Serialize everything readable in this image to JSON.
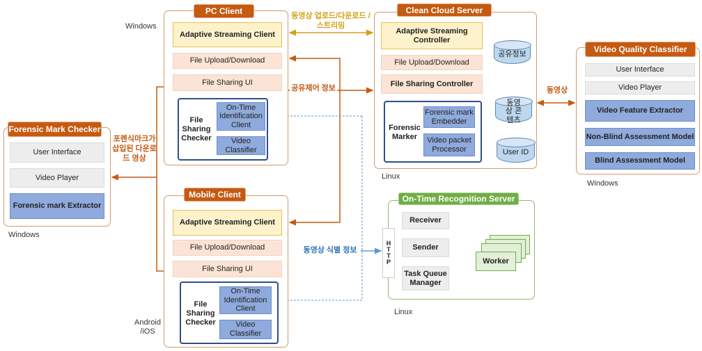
{
  "pc_client": {
    "title": "PC Client",
    "os": "Windows",
    "asc": "Adaptive Streaming Client",
    "fud": "File Upload/Download",
    "fsui": "File Sharing UI",
    "fsc_label": "File Sharing Checker",
    "otic": "On-Time Identification Client",
    "vc": "Video Classifier"
  },
  "mobile_client": {
    "title": "Mobile Client",
    "os": "Android /iOS",
    "asc": "Adaptive Streaming Client",
    "fud": "File Upload/Download",
    "fsui": "File Sharing UI",
    "fsc_label": "File Sharing Checker",
    "otic": "On-Time Identification Client",
    "vc": "Video Classifier"
  },
  "cloud": {
    "title": "Clean Cloud Server",
    "os": "Linux",
    "asc": "Adaptive Streaming Controller",
    "fud": "File Upload/Download",
    "fsc": "File Sharing Controller",
    "fm_label": "Forensic Marker",
    "fme": "Forensic mark Embedder",
    "vpp": "Video packet Processor",
    "db_share": "공유정보",
    "db_video": "동영상 콘텐츠",
    "db_user": "User ID"
  },
  "vqc": {
    "title": "Video Quality Classifier",
    "os": "Windows",
    "items": [
      "User Interface",
      "Video Player",
      "Video Feature Extractor",
      "Non-Blind Assessment Model",
      "Blind Assessment Model"
    ]
  },
  "fmc": {
    "title": "Forensic Mark Checker",
    "os": "Windows",
    "items": [
      "User Interface",
      "Video Player",
      "Forensic mark Extractor"
    ]
  },
  "otrs": {
    "title": "On-Time Recognition Server",
    "os": "Linux",
    "http": "HTTP",
    "receiver": "Receiver",
    "sender": "Sender",
    "tqm": "Task Queue Manager",
    "worker": "Worker"
  },
  "arrows": {
    "streaming": "동영상 업로드/다운로드 /스트리밍",
    "share_ctrl": "공유제어 정보",
    "forensic_video": "포렌식마크가 삽입된 다운로드 영상",
    "video": "동영상",
    "video_id": "동영상 식별 정보"
  },
  "colors": {
    "orange": "#c55a11",
    "gold": "#d4a017",
    "blue": "#5b9bd5",
    "green": "#6fae45"
  }
}
